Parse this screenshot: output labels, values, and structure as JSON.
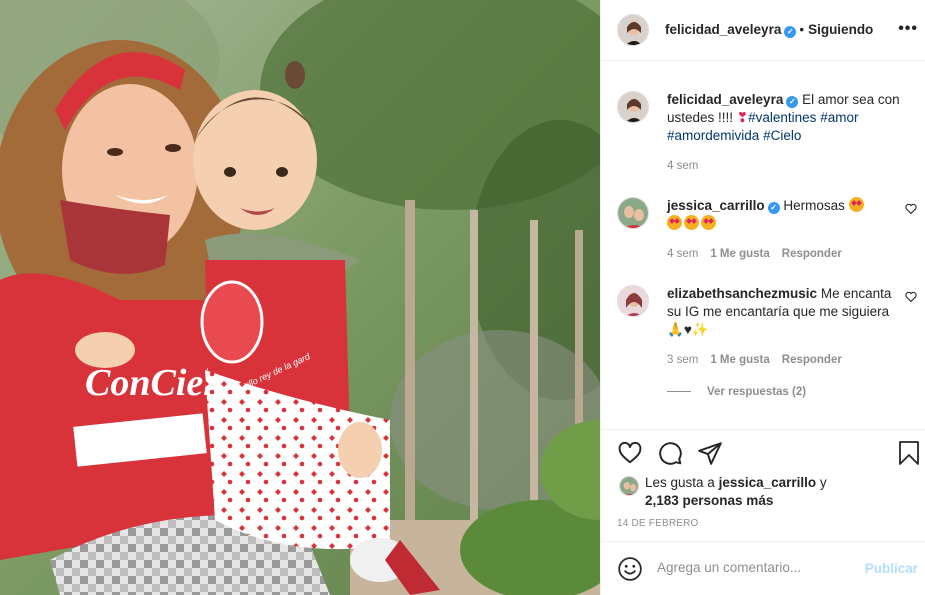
{
  "post": {
    "username": "felicidad_aveleyra",
    "follow_status": "Siguiendo",
    "more_label": "•••"
  },
  "caption": {
    "username": "felicidad_aveleyra",
    "text_plain": "El amor sea con ustedes !!!! ",
    "hashtags": [
      "#valentines",
      "#amor",
      "#amordemivida",
      "#Cielo"
    ],
    "time": "4 sem"
  },
  "comments": [
    {
      "username": "jessica_carrillo",
      "verified": true,
      "text": "Hermosas",
      "emoji_tail": [
        "heart-eyes",
        "heart-eyes",
        "heart-eyes",
        "heart-eyes"
      ],
      "time": "4 sem",
      "likes": "1 Me gusta",
      "reply": "Responder"
    },
    {
      "username": "elizabethsanchezmusic",
      "verified": false,
      "text": "Me encanta su IG me encantaría que me siguiera",
      "time": "3 sem",
      "likes": "1 Me gusta",
      "reply": "Responder"
    }
  ],
  "view_replies": "Ver respuestas (2)",
  "likes": {
    "prefix": "Les gusta a",
    "user": "jessica_carrillo",
    "connector": "y",
    "others": "2,183 personas más"
  },
  "date": "14 DE FEBRERO",
  "add_comment": {
    "placeholder": "Agrega un comentario...",
    "publish_label": "Publicar"
  },
  "photo": {
    "shirt_text": "ConCiel",
    "shirt_small_text": "agullo rey de la gard"
  },
  "colors": {
    "link": "#00376b",
    "muted": "#8e8e8e",
    "verified": "#3897f0",
    "publish_disabled": "#b2dffc"
  },
  "icons": [
    "heart-icon",
    "comment-icon",
    "share-icon",
    "bookmark-icon",
    "emoji-icon",
    "more-icon",
    "verified-icon"
  ]
}
